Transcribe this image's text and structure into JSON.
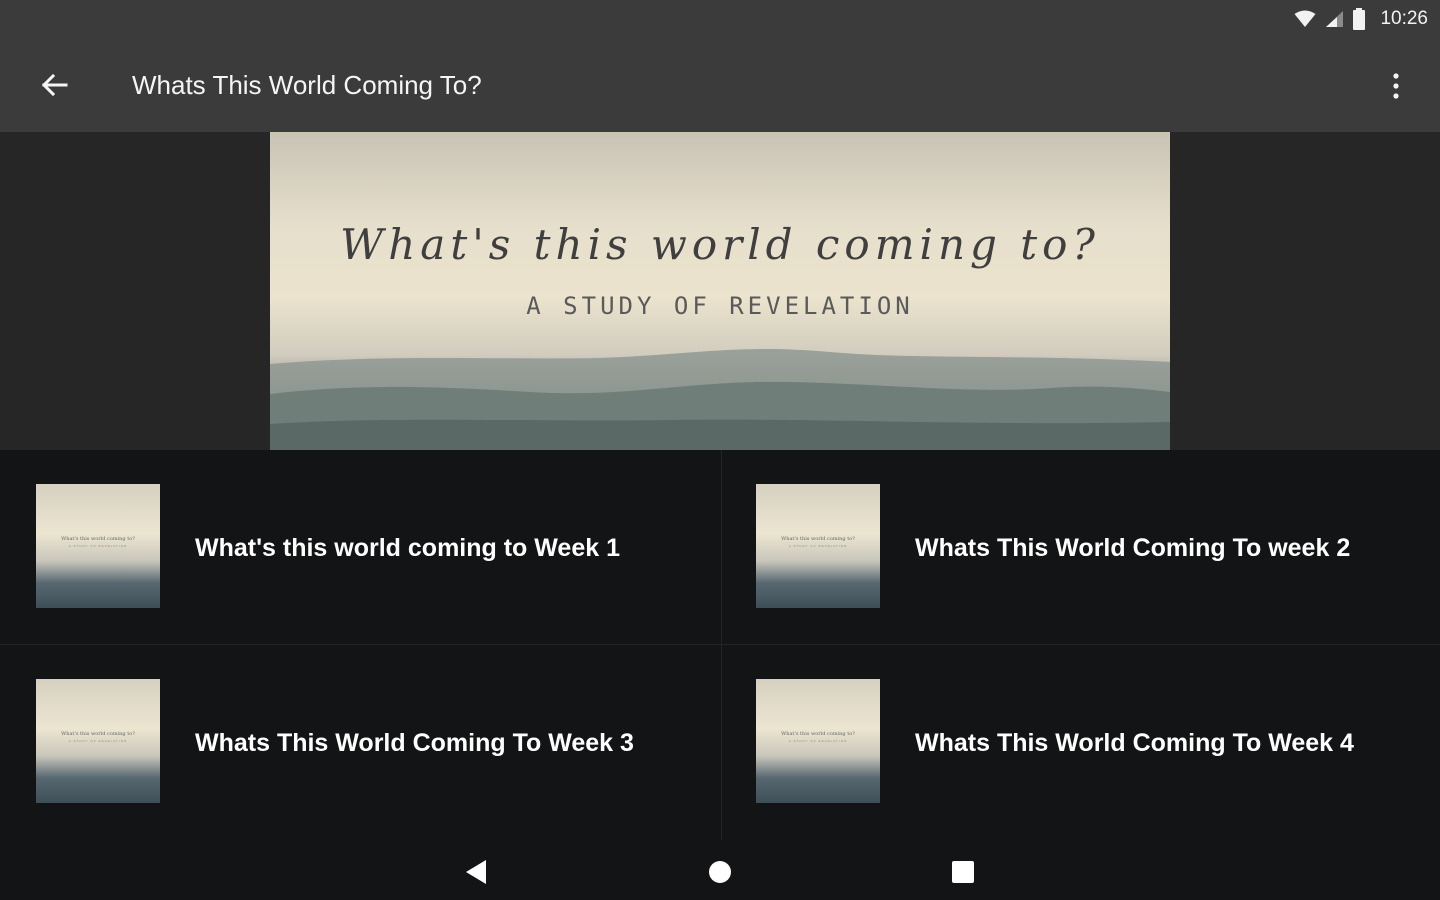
{
  "status_bar": {
    "time": "10:26",
    "icons": [
      "wifi-icon",
      "cell-signal-icon",
      "battery-icon"
    ]
  },
  "app_bar": {
    "title": "Whats This World Coming To?",
    "back_icon": "arrow-back-icon",
    "menu_icon": "more-vert-icon"
  },
  "hero": {
    "script_title": "What's this world coming to?",
    "subtitle": "A STUDY OF REVELATION"
  },
  "items": [
    {
      "label": "What's this world coming to Week 1",
      "thumb_title": "What's this world coming to?",
      "thumb_sub": "A STUDY OF REVELATION"
    },
    {
      "label": "Whats This World Coming To week 2",
      "thumb_title": "What's this world coming to?",
      "thumb_sub": "A STUDY OF REVELATION"
    },
    {
      "label": "Whats This World Coming To Week 3",
      "thumb_title": "What's this world coming to?",
      "thumb_sub": "A STUDY OF REVELATION"
    },
    {
      "label": "Whats This World Coming To Week 4",
      "thumb_title": "What's this world coming to?",
      "thumb_sub": "A STUDY OF REVELATION"
    }
  ],
  "nav_bar": {
    "icons": [
      "nav-back-icon",
      "nav-home-icon",
      "nav-recents-icon"
    ]
  },
  "colors": {
    "app_bar": "#3b3b3b",
    "hero_background": "#262626",
    "list_background": "#131416",
    "text": "#ffffff"
  }
}
